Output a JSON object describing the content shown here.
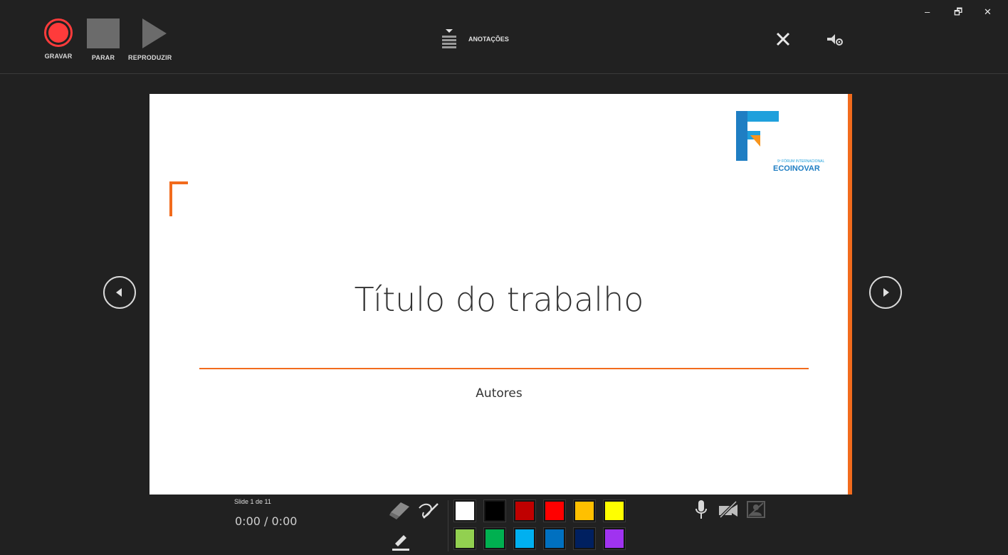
{
  "toolbar": {
    "record_label": "GRAVAR",
    "stop_label": "PARAR",
    "play_label": "REPRODUZIR",
    "notes_label": "ANOTAÇÕES"
  },
  "window_controls": {
    "minimize": "–",
    "restore": "🗗",
    "close": "✕"
  },
  "slide": {
    "title": "Título do trabalho",
    "subtitle": "Autores",
    "logo_small": "9º FÓRUM INTERNACIONAL",
    "logo_big": "ECOINOVAR"
  },
  "status": {
    "slide_counter": "Slide 1 de 11",
    "time": "0:00 / 0:00"
  },
  "palette": {
    "colors": [
      "#ffffff",
      "#000000",
      "#c00000",
      "#ff0000",
      "#ffc000",
      "#ffff00",
      "#92d050",
      "#00b050",
      "#00b0f0",
      "#0070c0",
      "#002060",
      "#a033f0"
    ]
  },
  "colors": {
    "accent": "#f26b1d",
    "record": "#ff3b3b",
    "background": "#212121"
  },
  "icons": [
    "record-icon",
    "stop-icon",
    "play-icon",
    "notes-icon",
    "close-icon",
    "settings-icon",
    "prev-slide-icon",
    "next-slide-icon",
    "eraser-icon",
    "pen-icon",
    "highlighter-icon",
    "microphone-icon",
    "camera-off-icon",
    "camera-preview-off-icon"
  ]
}
